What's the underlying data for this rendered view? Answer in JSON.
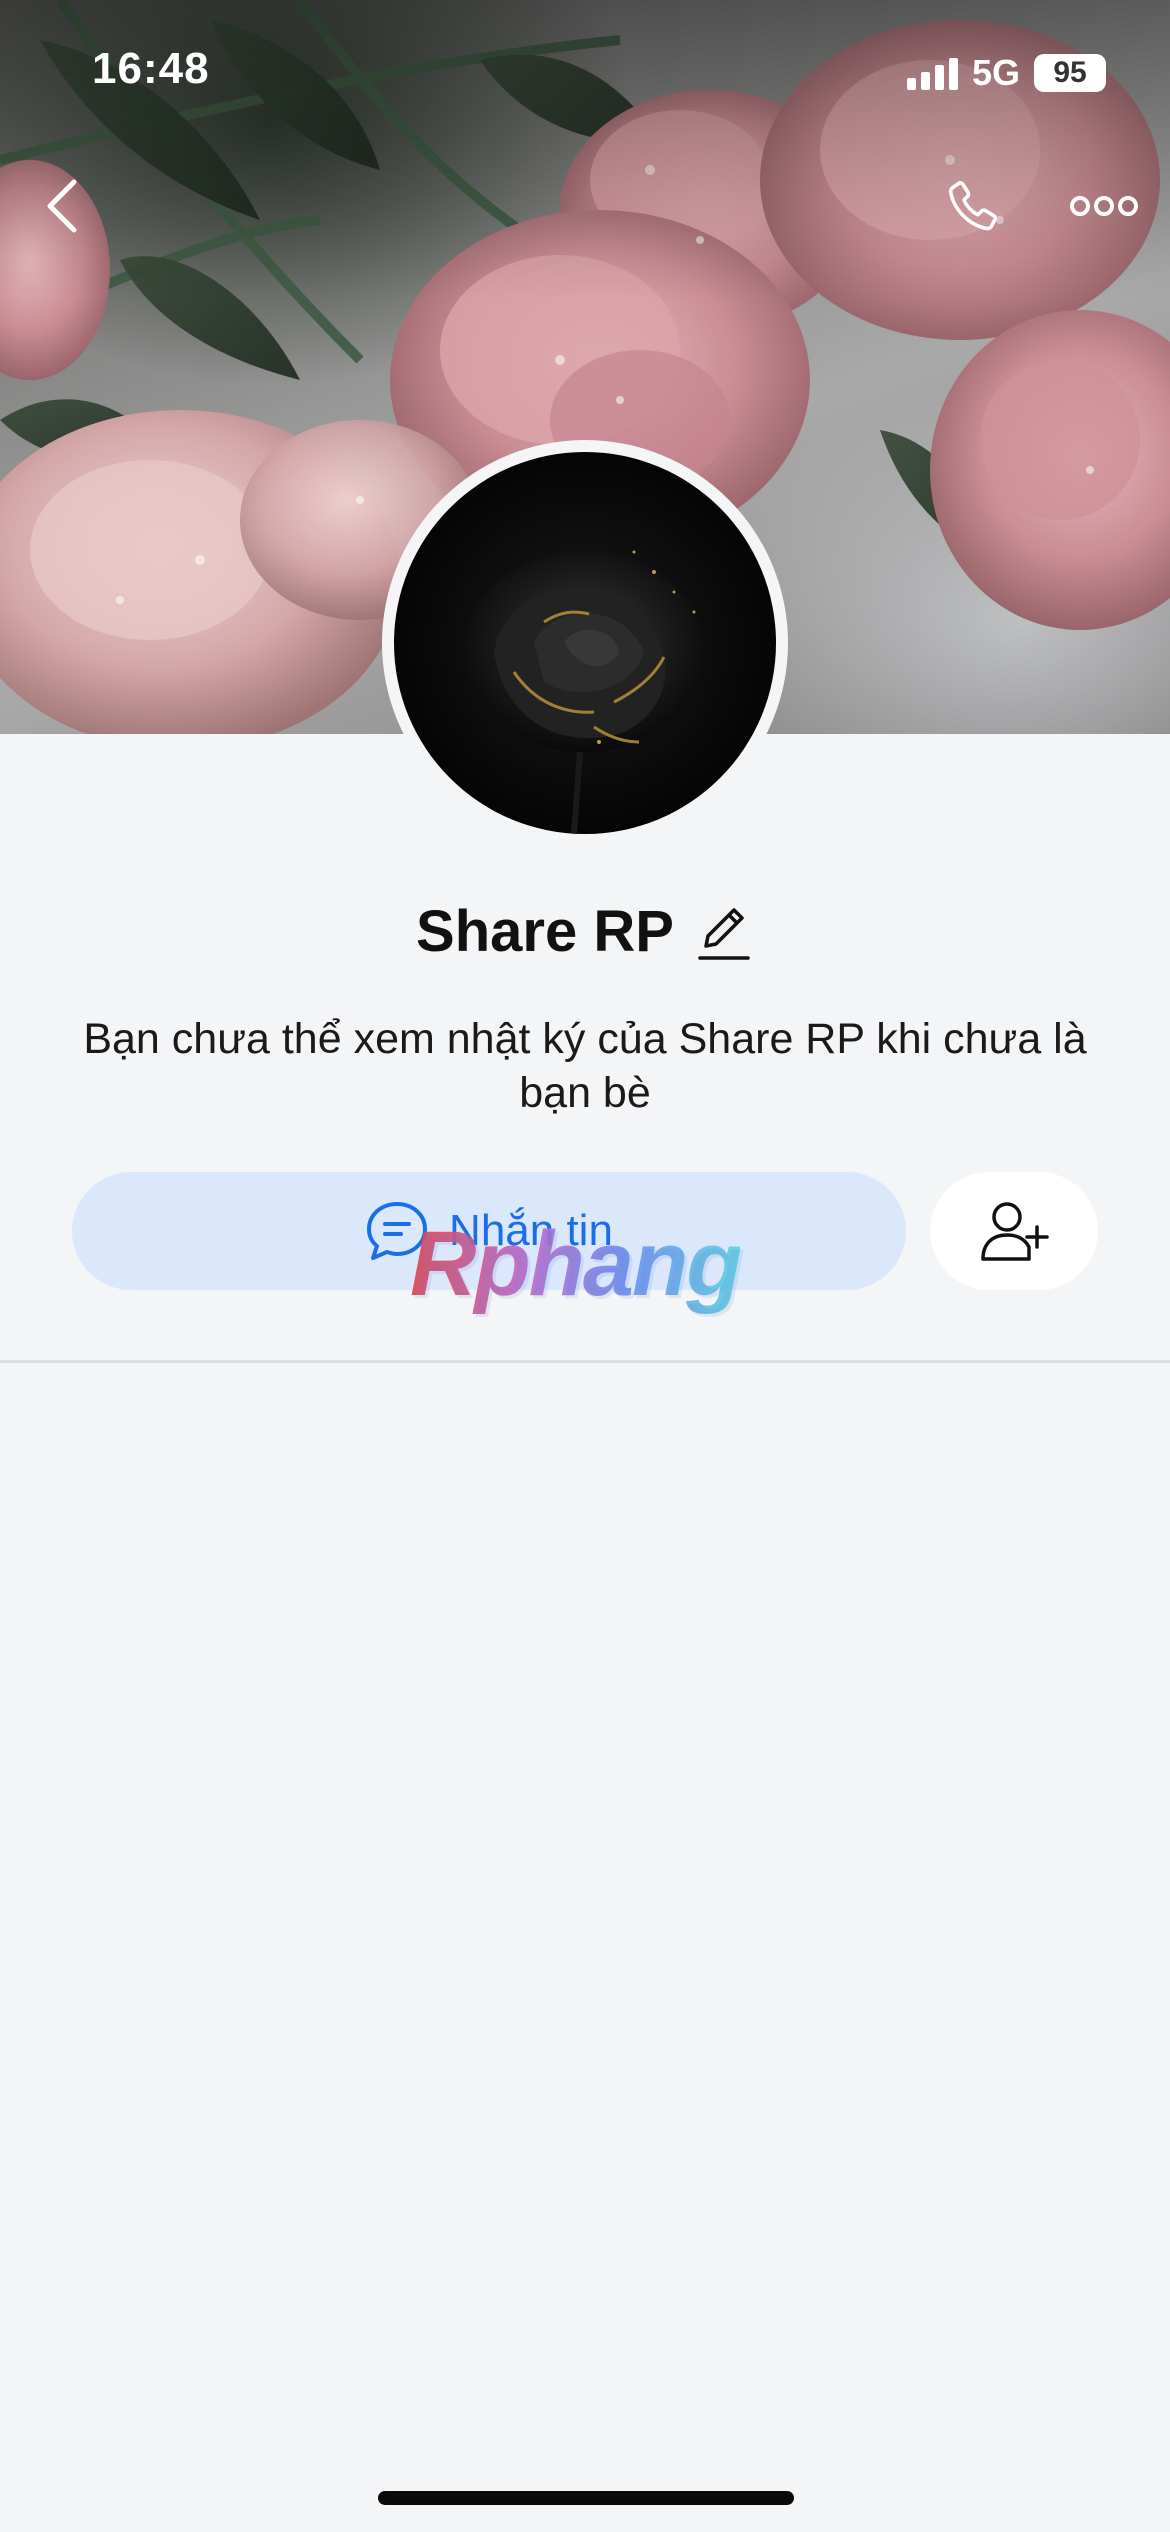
{
  "status_bar": {
    "time": "16:48",
    "network": "5G",
    "battery": "95"
  },
  "nav": {
    "back_icon": "chevron-left-icon",
    "call_icon": "phone-icon",
    "more_icon": "more-dots-icon"
  },
  "profile": {
    "name": "Share RP",
    "edit_icon": "pencil-icon",
    "note": "Bạn chưa thể xem nhật ký của Share RP khi chưa là bạn bè"
  },
  "actions": {
    "message_label": "Nhắn tin",
    "message_icon": "chat-bubble-icon",
    "add_friend_icon": "add-user-icon"
  },
  "watermark": {
    "text": "Rphang"
  },
  "colors": {
    "accent": "#1a6fe8",
    "message_button_bg": "#dbe8fc",
    "page_bg": "#f4f5f7"
  }
}
